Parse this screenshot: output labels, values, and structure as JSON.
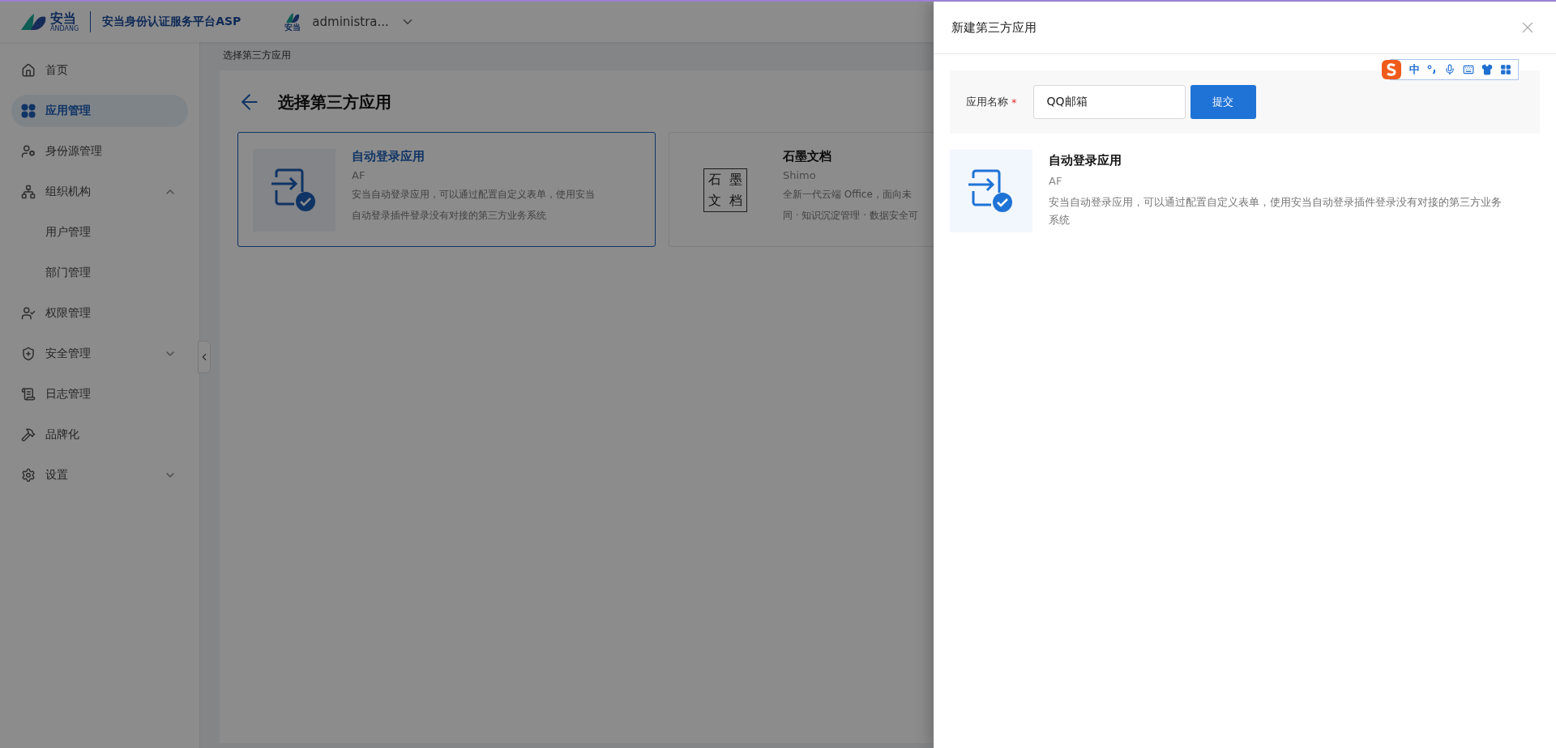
{
  "header": {
    "logo": {
      "name": "安当",
      "sub": "ANDANG"
    },
    "platform_title": "安当身份认证服务平台ASP",
    "user": {
      "badge": "安当",
      "name": "administra..."
    }
  },
  "sidebar": {
    "items": [
      {
        "label": "首页",
        "selected": false
      },
      {
        "label": "应用管理",
        "selected": true
      },
      {
        "label": "身份源管理",
        "selected": false
      },
      {
        "label": "组织机构",
        "selected": false,
        "expanded": true,
        "children": [
          {
            "label": "用户管理",
            "selected": false
          },
          {
            "label": "部门管理",
            "selected": false
          }
        ]
      },
      {
        "label": "权限管理",
        "selected": false
      },
      {
        "label": "安全管理",
        "selected": false,
        "expanded": false
      },
      {
        "label": "日志管理",
        "selected": false
      },
      {
        "label": "品牌化",
        "selected": false
      },
      {
        "label": "设置",
        "selected": false,
        "expanded": false
      }
    ]
  },
  "breadcrumb": "选择第三方应用",
  "page_title": "选择第三方应用",
  "cards": [
    {
      "kind": "autologin",
      "title": "自动登录应用",
      "code": "AF",
      "description": [
        "安当自动登录应用，可以通过配置自定义表单，使用安当",
        "自动登录插件登录没有对接的第三方业务系统"
      ],
      "selected": true
    },
    {
      "kind": "shimo",
      "logo_chars": [
        "石",
        "墨",
        "文",
        "档"
      ],
      "title": "石墨文档",
      "code": "Shimo",
      "description": [
        "全新一代云端 Office，面向未",
        "同 · 知识沉淀管理 · 数据安全可"
      ],
      "selected": false
    }
  ],
  "drawer": {
    "title": "新建第三方应用",
    "form": {
      "label": "应用名称",
      "required_mark": "*",
      "value": "QQ邮箱",
      "submit": "提交"
    },
    "app": {
      "title": "自动登录应用",
      "code": "AF",
      "description": "安当自动登录应用，可以通过配置自定义表单，使用安当自动登录插件登录没有对接的第三方业务系统"
    }
  },
  "ime_toolbar": {
    "mode": "中"
  }
}
